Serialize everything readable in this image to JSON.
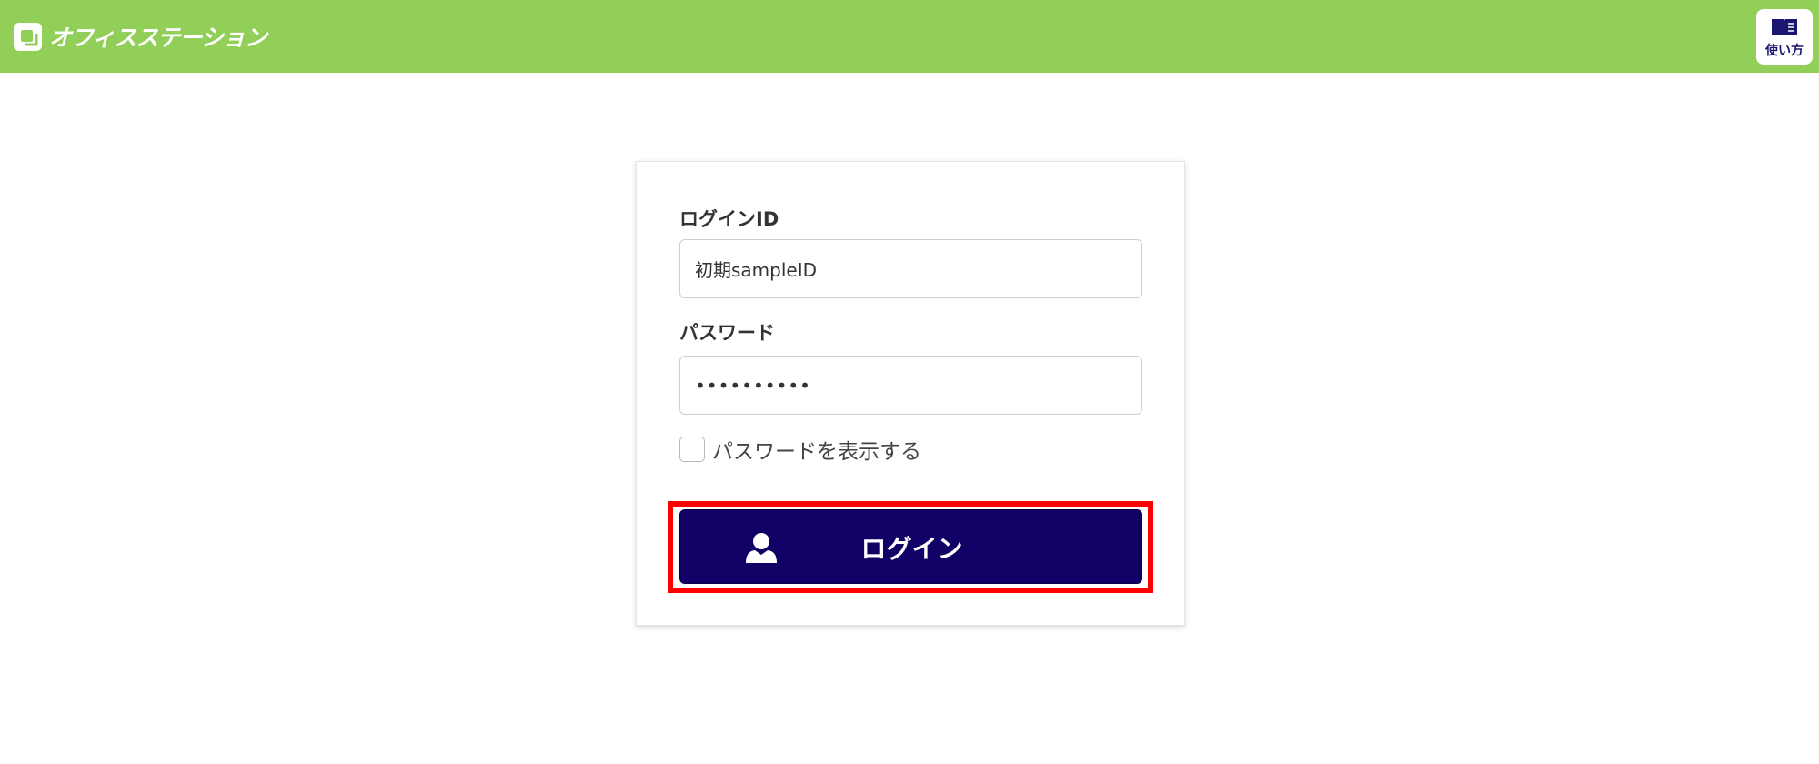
{
  "header": {
    "logo_text": "オフィスステーション",
    "help_label": "使い方"
  },
  "form": {
    "id_label": "ログインID",
    "id_value": "初期sampleID",
    "password_label": "パスワード",
    "password_value": "••••••••••",
    "show_password_label": "パスワードを表示する",
    "login_button_label": "ログイン"
  },
  "colors": {
    "header_bg": "#92cf58",
    "button_bg": "#130066",
    "highlight": "#ff0000"
  },
  "icons": {
    "logo": "office-station-logo-icon",
    "help": "book-icon",
    "login": "user-icon"
  }
}
